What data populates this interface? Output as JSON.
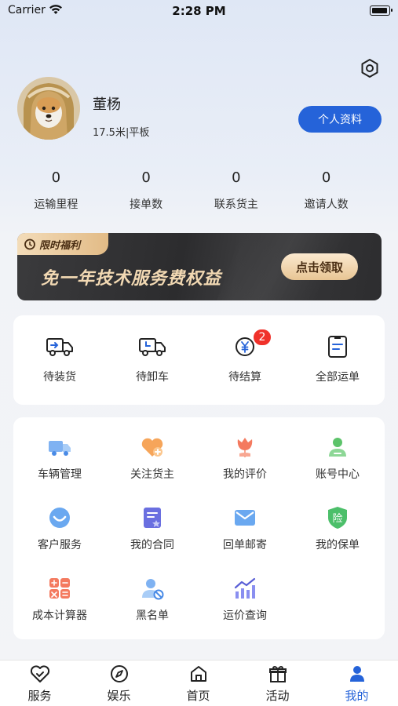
{
  "status_bar": {
    "carrier": "Carrier",
    "time": "2:28 PM"
  },
  "profile": {
    "name": "董杨",
    "vehicle": "17.5米|平板",
    "edit_button": "个人资料"
  },
  "stats": [
    {
      "value": "0",
      "label": "运输里程"
    },
    {
      "value": "0",
      "label": "接单数"
    },
    {
      "value": "0",
      "label": "联系货主"
    },
    {
      "value": "0",
      "label": "邀请人数"
    }
  ],
  "banner": {
    "tag": "限时福利",
    "title": "免一年技术服务费权益",
    "button": "点击领取"
  },
  "orders": [
    {
      "label": "待装货",
      "icon": "truck-load-icon"
    },
    {
      "label": "待卸车",
      "icon": "truck-unload-icon"
    },
    {
      "label": "待结算",
      "icon": "settlement-icon",
      "badge": "2"
    },
    {
      "label": "全部运单",
      "icon": "waybill-icon"
    }
  ],
  "services": [
    {
      "label": "车辆管理",
      "icon": "truck-icon"
    },
    {
      "label": "关注货主",
      "icon": "heart-plus-icon"
    },
    {
      "label": "我的评价",
      "icon": "flower-icon"
    },
    {
      "label": "账号中心",
      "icon": "account-icon"
    },
    {
      "label": "客户服务",
      "icon": "customer-service-icon"
    },
    {
      "label": "我的合同",
      "icon": "contract-icon"
    },
    {
      "label": "回单邮寄",
      "icon": "mail-icon"
    },
    {
      "label": "我的保单",
      "icon": "insurance-icon"
    },
    {
      "label": "成本计算器",
      "icon": "calculator-icon"
    },
    {
      "label": "黑名单",
      "icon": "blacklist-icon"
    },
    {
      "label": "运价查询",
      "icon": "price-chart-icon"
    }
  ],
  "insurance_glyph": "险",
  "tabs": [
    {
      "label": "服务",
      "icon": "heart-check-icon",
      "active": false
    },
    {
      "label": "娱乐",
      "icon": "compass-icon",
      "active": false
    },
    {
      "label": "首页",
      "icon": "home-icon",
      "active": false
    },
    {
      "label": "活动",
      "icon": "gift-icon",
      "active": false
    },
    {
      "label": "我的",
      "icon": "user-icon",
      "active": true
    }
  ],
  "colors": {
    "accent": "#2563d9",
    "badge": "#f0312a",
    "banner_gold": "#f2d9b3"
  }
}
